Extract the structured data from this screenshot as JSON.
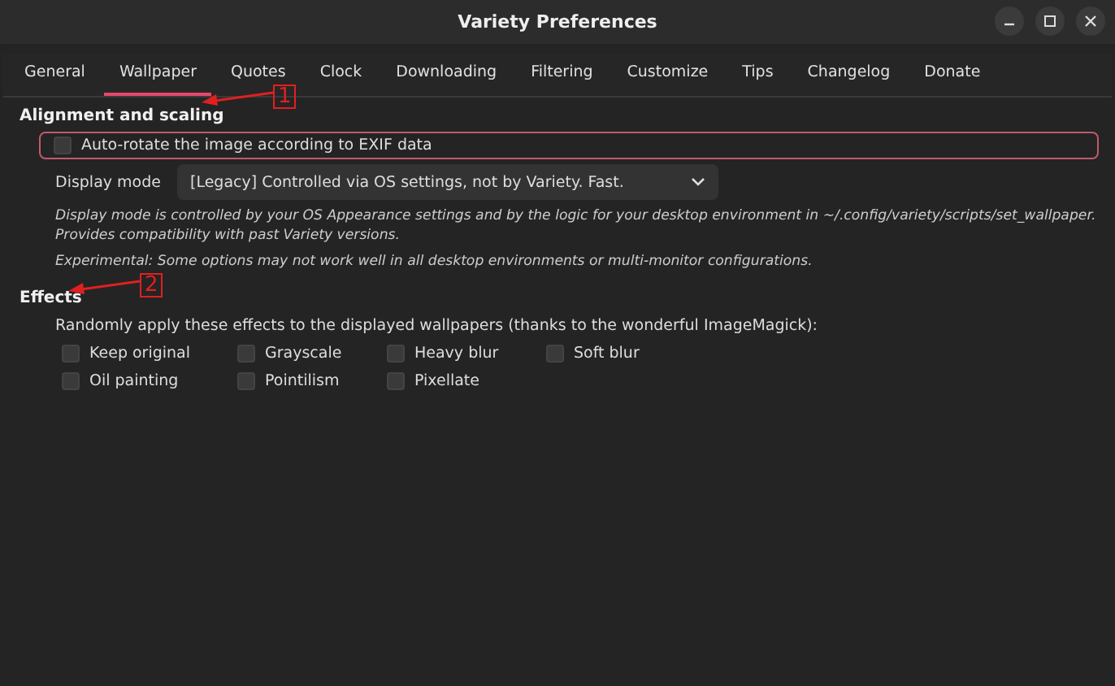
{
  "window": {
    "title": "Variety Preferences"
  },
  "tabs": [
    {
      "label": "General",
      "selected": false
    },
    {
      "label": "Wallpaper",
      "selected": true
    },
    {
      "label": "Quotes",
      "selected": false
    },
    {
      "label": "Clock",
      "selected": false
    },
    {
      "label": "Downloading",
      "selected": false
    },
    {
      "label": "Filtering",
      "selected": false
    },
    {
      "label": "Customize",
      "selected": false
    },
    {
      "label": "Tips",
      "selected": false
    },
    {
      "label": "Changelog",
      "selected": false
    },
    {
      "label": "Donate",
      "selected": false
    }
  ],
  "alignment": {
    "heading": "Alignment and scaling",
    "auto_rotate": {
      "label": "Auto-rotate the image according to EXIF data",
      "checked": false
    },
    "display_mode": {
      "label": "Display mode",
      "value": "[Legacy] Controlled via OS settings, not by Variety. Fast."
    },
    "notes": [
      "Display mode is controlled by your OS Appearance settings and by the logic for your desktop environment in ~/.config/variety/scripts/set_wallpaper. Provides compatibility with past Variety versions.",
      "Experimental: Some options may not work well in all desktop environments or multi-monitor configurations."
    ]
  },
  "effects": {
    "heading": "Effects",
    "description": "Randomly apply these effects to the displayed wallpapers (thanks to the wonderful ImageMagick):",
    "options": [
      {
        "label": "Keep original",
        "checked": false
      },
      {
        "label": "Grayscale",
        "checked": false
      },
      {
        "label": "Heavy blur",
        "checked": false
      },
      {
        "label": "Soft blur",
        "checked": false
      },
      {
        "label": "Oil painting",
        "checked": false
      },
      {
        "label": "Pointilism",
        "checked": false
      },
      {
        "label": "Pixellate",
        "checked": false
      }
    ]
  },
  "annotations": [
    {
      "label": "1"
    },
    {
      "label": "2"
    }
  ]
}
